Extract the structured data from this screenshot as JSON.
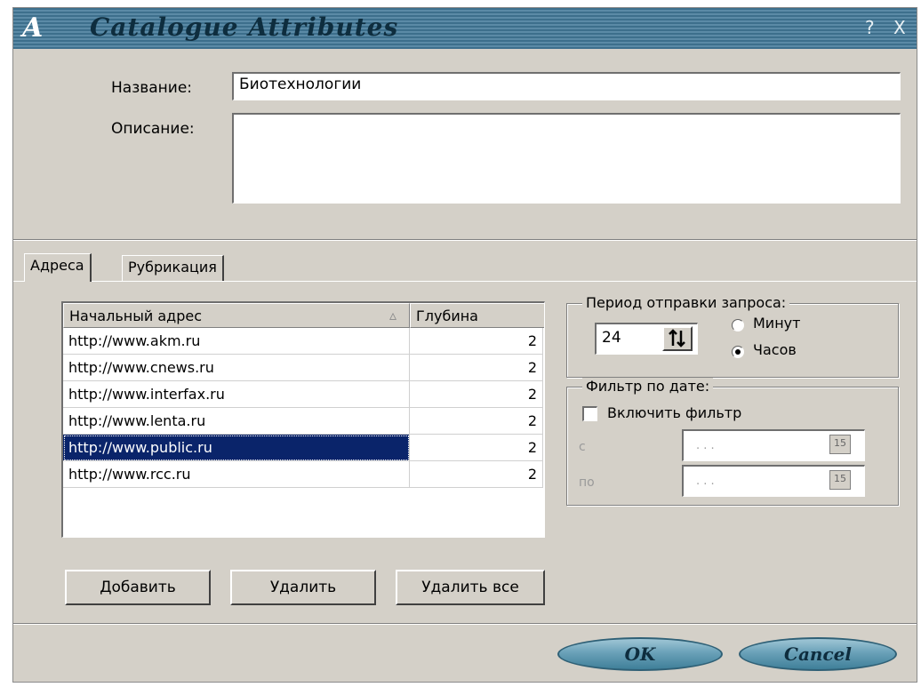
{
  "window": {
    "logo": "A",
    "title": "Catalogue Attributes",
    "help_label": "?",
    "close_label": "X"
  },
  "form": {
    "name_label": "Название:",
    "name_value": "Биотехнологии",
    "desc_label": "Описание:",
    "desc_value": ""
  },
  "tabs": [
    {
      "label": "Адреса",
      "active": true
    },
    {
      "label": "Рубрикация",
      "active": false
    }
  ],
  "table": {
    "columns": [
      "Начальный адрес",
      "Глубина"
    ],
    "sort_indicator": "▵",
    "rows": [
      {
        "url": "http://www.akm.ru",
        "depth": "2"
      },
      {
        "url": "http://www.cnews.ru",
        "depth": "2"
      },
      {
        "url": "http://www.interfax.ru",
        "depth": "2"
      },
      {
        "url": "http://www.lenta.ru",
        "depth": "2"
      },
      {
        "url": "http://www.public.ru",
        "depth": "2"
      },
      {
        "url": "http://www.rcc.ru",
        "depth": "2"
      }
    ],
    "selected_row": 4
  },
  "buttons": {
    "add": "Добавить",
    "remove": "Удалить",
    "remove_all": "Удалить все"
  },
  "period": {
    "legend": "Период отправки запроса:",
    "value": "24",
    "spin_icon": "spin-arrows-icon",
    "option_minutes": "Минут",
    "option_hours": "Часов",
    "selected": "hours"
  },
  "date_filter": {
    "legend": "Фильтр по дате:",
    "enable_label": "Включить фильтр",
    "enabled": false,
    "from_label": "с",
    "to_label": "по",
    "from_value": ". . .",
    "to_value": ". . .",
    "calendar_glyph": "15"
  },
  "footer": {
    "ok_label": "OK",
    "cancel_label": "Cancel"
  },
  "colors": {
    "titlebar": "#4a7d99",
    "selection": "#0a246a",
    "dialog_bg": "#d4d0c8",
    "oval_button": "#6aa1b8"
  }
}
